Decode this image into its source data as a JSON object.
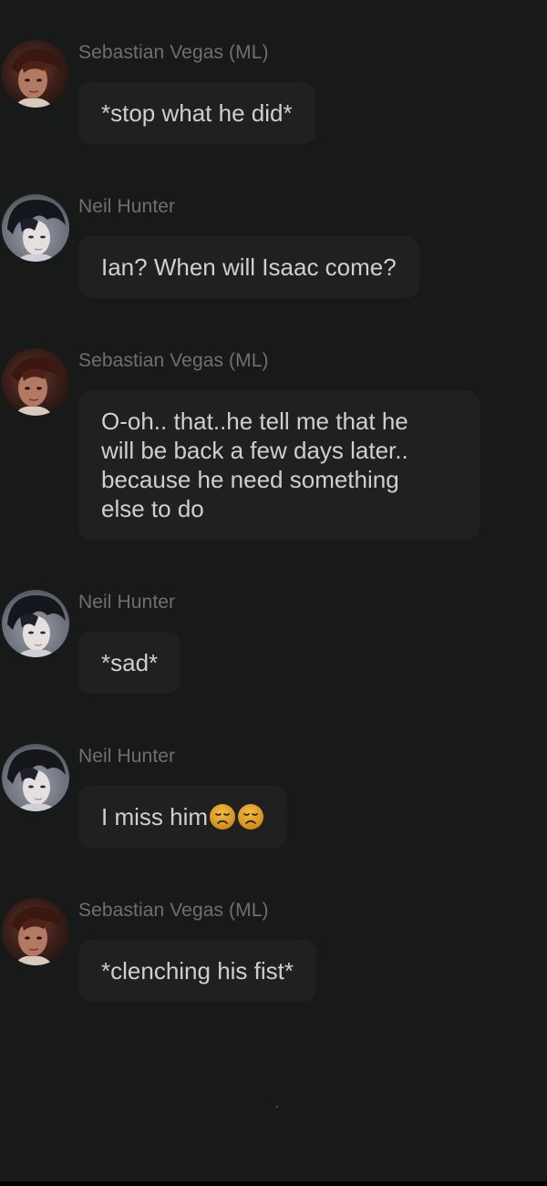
{
  "chat": {
    "messages": [
      {
        "sender": "Sebastian Vegas (ML)",
        "avatar": "avatar-sebastian",
        "lines": [
          "*stop what he did*"
        ]
      },
      {
        "sender": "Neil Hunter",
        "avatar": "avatar-neil",
        "lines": [
          "Ian? When will Isaac come?"
        ]
      },
      {
        "sender": "Sebastian Vegas (ML)",
        "avatar": "avatar-sebastian",
        "lines": [
          "O-oh.. that..he tell me that he",
          "will be back a few days later..",
          "because he need something",
          "else to do"
        ]
      },
      {
        "sender": "Neil Hunter",
        "avatar": "avatar-neil",
        "lines": [
          "*sad*"
        ]
      },
      {
        "sender": "Neil Hunter",
        "avatar": "avatar-neil",
        "lines": [
          "I miss him"
        ],
        "emoji": [
          "disappointed-face-icon",
          "disappointed-face-icon"
        ]
      },
      {
        "sender": "Sebastian Vegas (ML)",
        "avatar": "avatar-sebastian",
        "lines": [
          "*clenching his fist*"
        ]
      }
    ]
  },
  "colors": {
    "background": "#181919",
    "bubble": "#202020",
    "sender_text": "#6f6f6f",
    "message_text": "#cfcfcf",
    "emoji": "#e0a12a"
  }
}
